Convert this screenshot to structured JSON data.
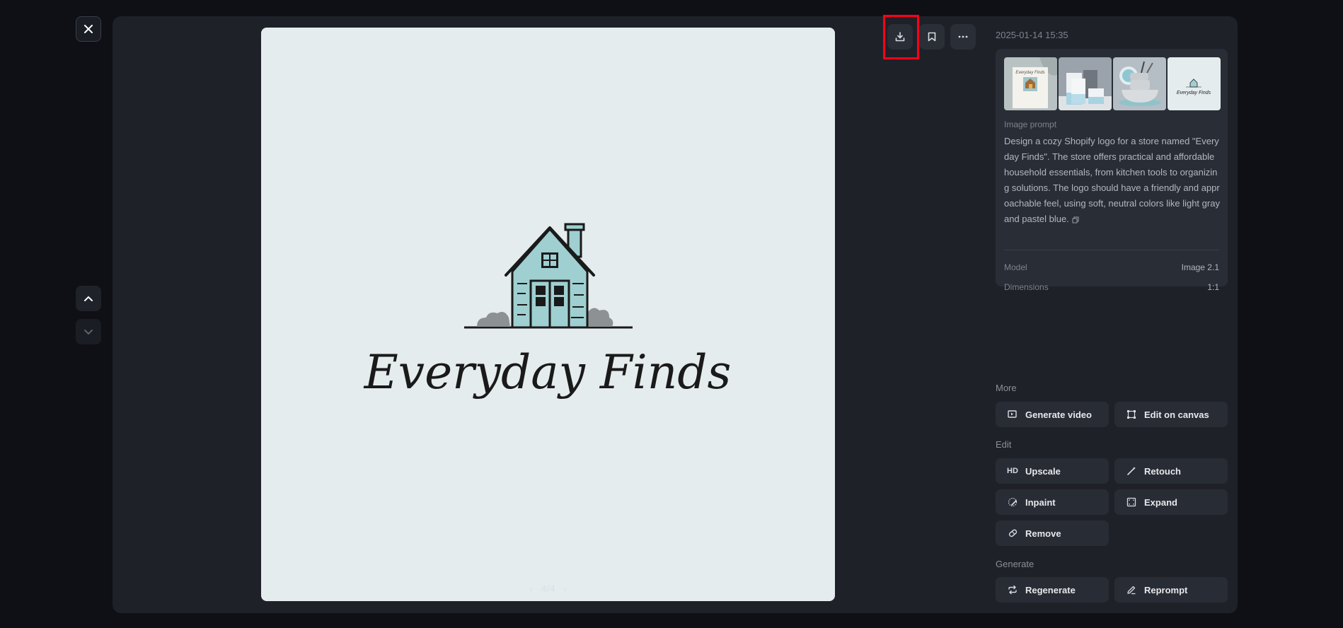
{
  "viewer": {
    "close_label": "Close",
    "pager": {
      "current": 4,
      "total": 4,
      "text": "4/4"
    }
  },
  "toolbar": {
    "download": "download-icon",
    "bookmark": "bookmark-icon",
    "more": "more-icon"
  },
  "image": {
    "logo_text": "Everyday Finds",
    "colors": {
      "background": "#e5ecee",
      "house": "#9fcfd1",
      "ink": "#1a1a1a",
      "bush": "#8e9193"
    }
  },
  "details": {
    "timestamp": "2025-01-14 15:35",
    "thumbnails": [
      {
        "alt": "Everyday Finds card mockup"
      },
      {
        "alt": "Everyday Finds packaging boxes"
      },
      {
        "alt": "Everyday Finds kitchen bowls"
      },
      {
        "alt": "Everyday Finds logo"
      }
    ],
    "prompt_label": "Image prompt",
    "prompt": "Design a cozy Shopify logo for a store named \"Everyday Finds\". The store offers practical and affordable household essentials, from kitchen tools to organizing solutions. The logo should have a friendly and approachable feel, using soft, neutral colors like light gray and pastel blue.",
    "model_label": "Model",
    "model_value": "Image 2.1",
    "dimensions_label": "Dimensions",
    "dimensions_value": "1:1"
  },
  "sections": {
    "more": {
      "label": "More",
      "buttons": [
        {
          "label": "Generate video",
          "icon": "video-icon"
        },
        {
          "label": "Edit on canvas",
          "icon": "canvas-icon"
        }
      ]
    },
    "edit": {
      "label": "Edit",
      "buttons": [
        {
          "label": "Upscale",
          "icon": "hd-icon",
          "icon_text": "HD"
        },
        {
          "label": "Retouch",
          "icon": "magic-wand-icon"
        },
        {
          "label": "Inpaint",
          "icon": "inpaint-icon"
        },
        {
          "label": "Expand",
          "icon": "expand-icon"
        },
        {
          "label": "Remove",
          "icon": "eraser-icon"
        }
      ]
    },
    "generate": {
      "label": "Generate",
      "buttons": [
        {
          "label": "Regenerate",
          "icon": "repeat-icon"
        },
        {
          "label": "Reprompt",
          "icon": "pencil-icon"
        }
      ]
    }
  }
}
